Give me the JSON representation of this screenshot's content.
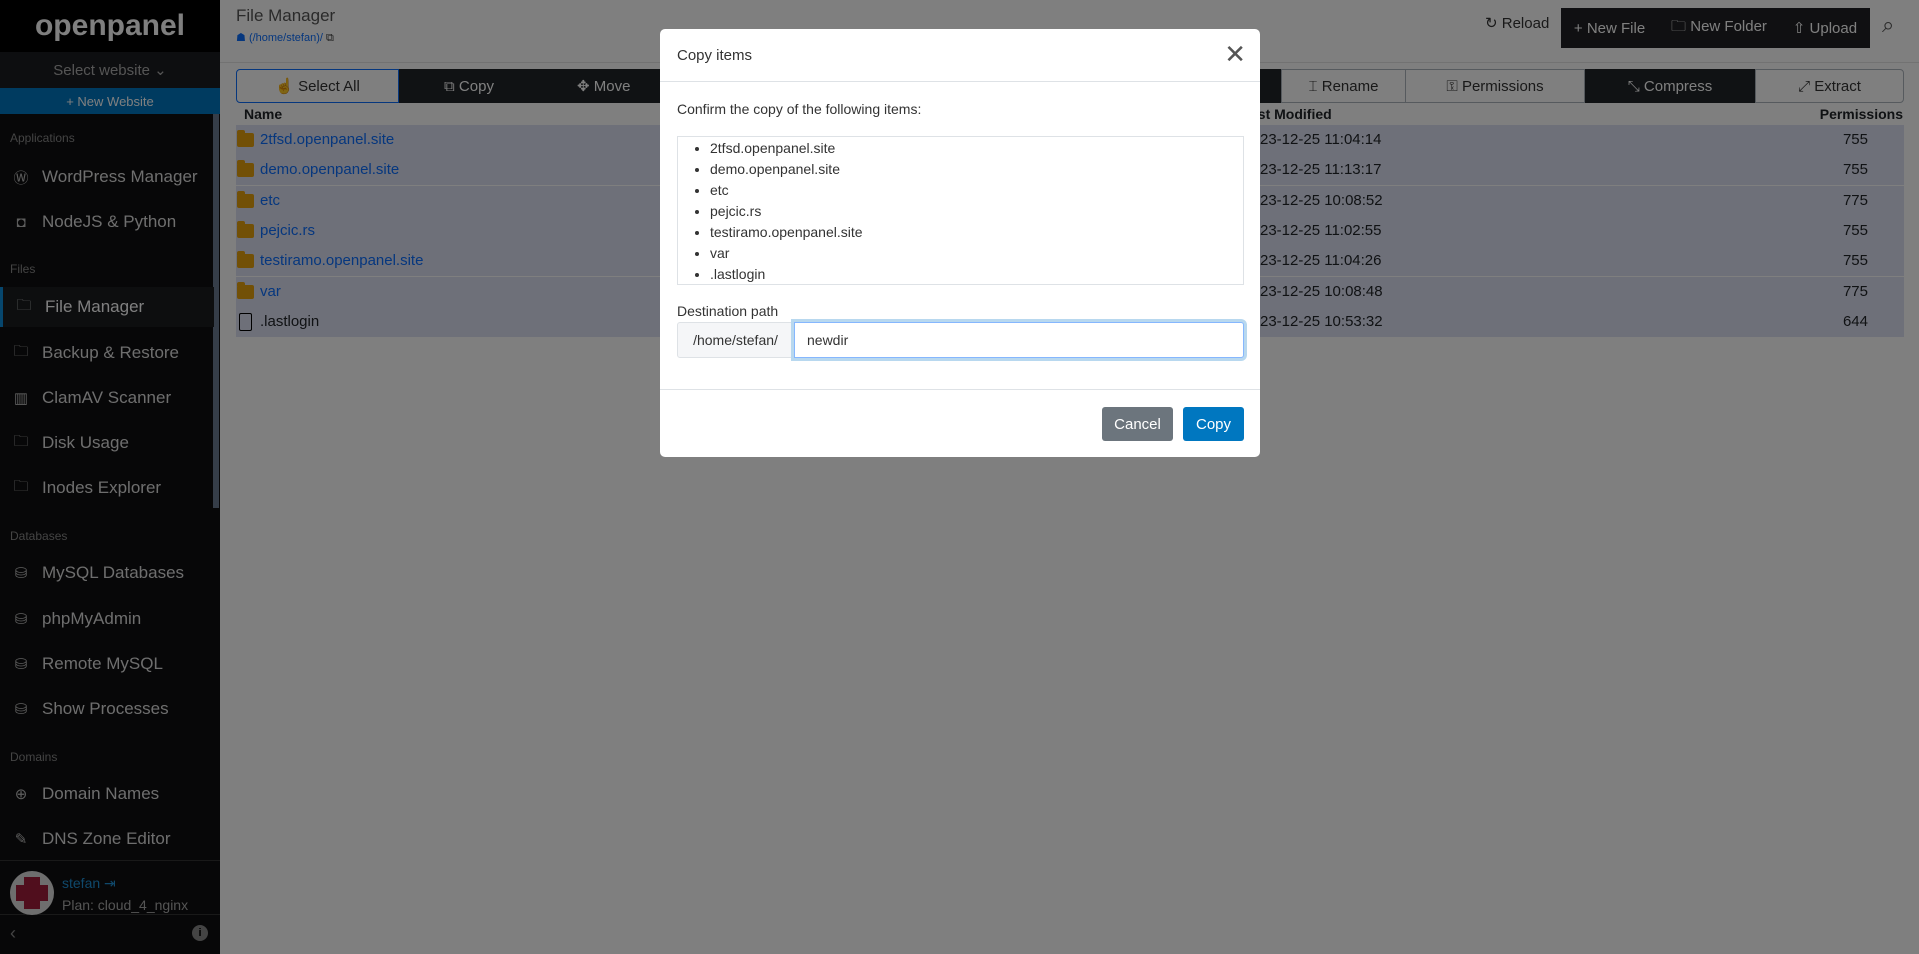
{
  "sidebar": {
    "logo": "openpanel",
    "select_website": "Select website ⌄",
    "new_website": "+ New Website",
    "sections": [
      {
        "label": "Applications"
      },
      {
        "label": "Files"
      },
      {
        "label": "Databases"
      },
      {
        "label": "Domains"
      }
    ],
    "items": [
      {
        "label": "WordPress Manager",
        "icon": "wordpress-icon"
      },
      {
        "label": "NodeJS & Python",
        "icon": "nodejs-icon"
      },
      {
        "label": "File Manager",
        "icon": "folder-icon",
        "active": true
      },
      {
        "label": "Backup & Restore",
        "icon": "backup-icon"
      },
      {
        "label": "ClamAV Scanner",
        "icon": "scanner-icon"
      },
      {
        "label": "Disk Usage",
        "icon": "disk-icon"
      },
      {
        "label": "Inodes Explorer",
        "icon": "inodes-icon"
      },
      {
        "label": "MySQL Databases",
        "icon": "database-icon"
      },
      {
        "label": "phpMyAdmin",
        "icon": "phpmyadmin-icon"
      },
      {
        "label": "Remote MySQL",
        "icon": "remote-db-icon"
      },
      {
        "label": "Show Processes",
        "icon": "processes-icon"
      },
      {
        "label": "Domain Names",
        "icon": "globe-icon"
      },
      {
        "label": "DNS Zone Editor",
        "icon": "edit-icon"
      }
    ],
    "user": {
      "name": "stefan",
      "plan": "Plan: cloud_4_nginx"
    }
  },
  "header": {
    "title": "File Manager",
    "breadcrumb": "(/home/stefan)/",
    "reload": "Reload",
    "new_file": "+ New File",
    "new_folder": "New Folder",
    "upload": "Upload"
  },
  "toolbar": {
    "select_all": "Select All",
    "copy": "Copy",
    "move": "Move",
    "rename": "Rename",
    "permissions": "Permissions",
    "compress": "Compress",
    "extract": "Extract"
  },
  "table": {
    "headers": {
      "name": "Name",
      "modified": "ast Modified",
      "permissions": "Permissions"
    },
    "rows": [
      {
        "name": "2tfsd.openpanel.site",
        "type": "folder",
        "modified": "23-12-25 11:04:14",
        "permissions": "755"
      },
      {
        "name": "demo.openpanel.site",
        "type": "folder",
        "modified": "23-12-25 11:13:17",
        "permissions": "755"
      },
      {
        "name": "etc",
        "type": "folder",
        "modified": "23-12-25 10:08:52",
        "permissions": "775"
      },
      {
        "name": "pejcic.rs",
        "type": "folder",
        "modified": "23-12-25 11:02:55",
        "permissions": "755"
      },
      {
        "name": "testiramo.openpanel.site",
        "type": "folder",
        "modified": "23-12-25 11:04:26",
        "permissions": "755"
      },
      {
        "name": "var",
        "type": "folder",
        "modified": "23-12-25 10:08:48",
        "permissions": "775"
      },
      {
        "name": ".lastlogin",
        "type": "file",
        "modified": "23-12-25 10:53:32",
        "permissions": "644"
      }
    ]
  },
  "modal": {
    "title": "Copy items",
    "confirm": "Confirm the copy of the following items:",
    "items": [
      "2tfsd.openpanel.site",
      "demo.openpanel.site",
      "etc",
      "pejcic.rs",
      "testiramo.openpanel.site",
      "var",
      ".lastlogin"
    ],
    "dest_label": "Destination path",
    "dest_prefix": "/home/stefan/",
    "dest_value": "newdir",
    "cancel": "Cancel",
    "copy": "Copy"
  },
  "colors": {
    "accent": "#0077c0",
    "cancel": "#6c757d",
    "folder": "#e5a00d"
  }
}
